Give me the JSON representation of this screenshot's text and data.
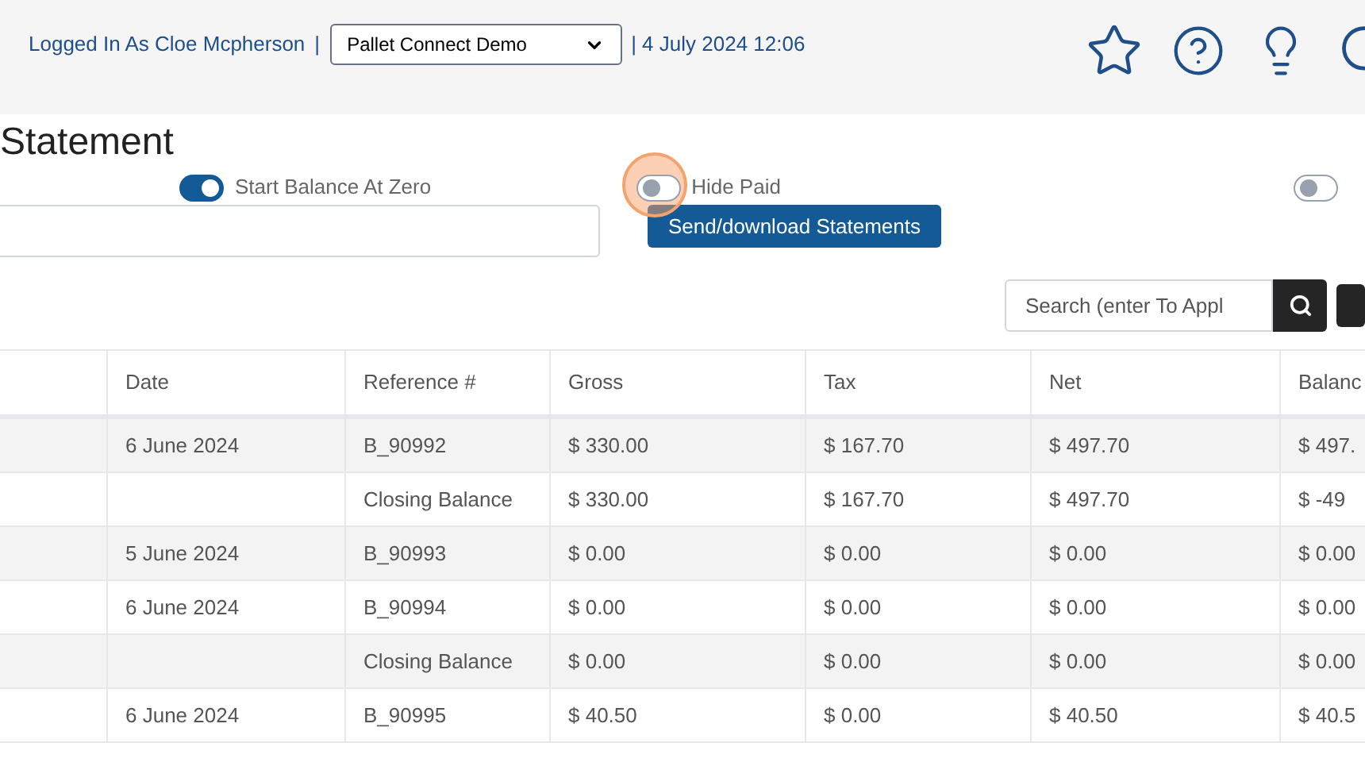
{
  "header": {
    "user": "Logged In As Cloe Mcpherson",
    "separator": "|",
    "company": "Pallet Connect Demo",
    "datetime": "| 4 July 2024 12:06"
  },
  "page_title": "Statement",
  "toggles": [
    {
      "label": "Start Balance At Zero",
      "on": true
    },
    {
      "label": "Hide Paid",
      "on": false,
      "highlighted": true
    },
    {
      "on": false
    }
  ],
  "send_button": "Send/download Statements",
  "search": {
    "placeholder": "Search (enter To Appl"
  },
  "table": {
    "columns": [
      "Date",
      "Reference #",
      "Gross",
      "Tax",
      "Net",
      "Balanc"
    ],
    "rows": [
      {
        "date": "6 June 2024",
        "reference": "B_90992",
        "gross": "$ 330.00",
        "tax": "$ 167.70",
        "net": "$ 497.70",
        "balance": "$ 497."
      },
      {
        "reference": "Closing Balance",
        "gross": "$ 330.00",
        "tax": "$ 167.70",
        "net": "$ 497.70",
        "balance": "$ -49"
      },
      {
        "date": "5 June 2024",
        "reference": "B_90993",
        "gross": "$ 0.00",
        "tax": "$ 0.00",
        "net": "$ 0.00",
        "balance": "$ 0.00"
      },
      {
        "date": "6 June 2024",
        "reference": "B_90994",
        "gross": "$ 0.00",
        "tax": "$ 0.00",
        "net": "$ 0.00",
        "balance": "$ 0.00"
      },
      {
        "reference": "Closing Balance",
        "gross": "$ 0.00",
        "tax": "$ 0.00",
        "net": "$ 0.00",
        "balance": "$ 0.00"
      },
      {
        "date": "6 June 2024",
        "reference": "B_90995",
        "gross": "$ 40.50",
        "tax": "$ 0.00",
        "net": "$ 40.50",
        "balance": "$ 40.5"
      }
    ]
  }
}
